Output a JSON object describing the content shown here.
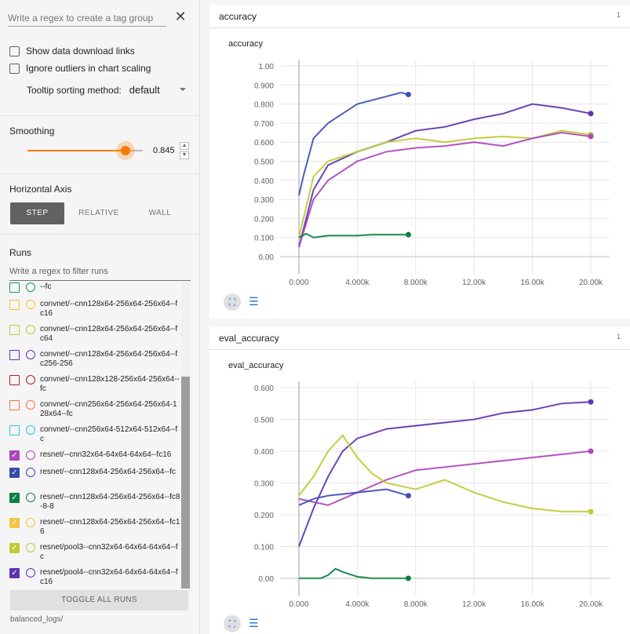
{
  "sidebar": {
    "tag_regex_placeholder": "Write a regex to create a tag group",
    "show_download_links": "Show data download links",
    "ignore_outliers": "Ignore outliers in chart scaling",
    "tooltip_sorting_label": "Tooltip sorting method:",
    "tooltip_sorting_value": "default",
    "smoothing_title": "Smoothing",
    "smoothing_value": "0.845",
    "smoothing_level": 0.845,
    "horizontal_axis_title": "Horizontal Axis",
    "axis_buttons": [
      "STEP",
      "RELATIVE",
      "WALL"
    ],
    "axis_selected": "STEP",
    "runs_title": "Runs",
    "runs_filter_placeholder": "Write a regex to filter runs",
    "runs": [
      {
        "label": "--fc",
        "color": "#0f9d58",
        "checked": false
      },
      {
        "label": "convnet/--cnn128x64-256x64-256x64--fc16",
        "color": "#f4c430",
        "checked": false
      },
      {
        "label": "convnet/--cnn128x64-256x64-256x64--fc64",
        "color": "#c0ca33",
        "checked": false
      },
      {
        "label": "convnet/--cnn128x64-256x64-256x64--fc256-256",
        "color": "#5e35b1",
        "checked": false
      },
      {
        "label": "convnet/--cnn128x128-256x64-256x64--fc",
        "color": "#b71c1c",
        "checked": false
      },
      {
        "label": "convnet/--cnn256x64-256x64-256x64-128x64--fc",
        "color": "#ff7043",
        "checked": false
      },
      {
        "label": "convnet/--cnn256x64-512x64-512x64--fc",
        "color": "#26c6da",
        "checked": false
      },
      {
        "label": "resnet/--cnn32x64-64x64-64x64--fc16",
        "color": "#ab47bc",
        "checked": true
      },
      {
        "label": "resnet/--cnn128x64-256x64-256x64--fc",
        "color": "#3949ab",
        "checked": true
      },
      {
        "label": "resnet/--cnn128x64-256x64-256x64--fc8-8-8",
        "color": "#0b8043",
        "checked": true
      },
      {
        "label": "resnet/--cnn128x64-256x64-256x64--fc16",
        "color": "#f6c342",
        "checked": true
      },
      {
        "label": "resnet/pool3--cnn32x64-64x64-64x64--fc",
        "color": "#c0ca33",
        "checked": true
      },
      {
        "label": "resnet/pool4--cnn32x64-64x64-64x64--fc16",
        "color": "#5e35b1",
        "checked": true
      }
    ],
    "toggle_all": "TOGGLE ALL RUNS",
    "logdir": "balanced_logs/"
  },
  "main": {
    "cards": [
      {
        "tag": "accuracy",
        "count": "1",
        "chart_title": "accuracy"
      },
      {
        "tag": "eval_accuracy",
        "count": "1",
        "chart_title": "eval_accuracy"
      }
    ]
  },
  "chart_data": [
    {
      "type": "line",
      "title": "accuracy",
      "xlim": [
        0,
        20000
      ],
      "ylim": [
        0,
        1.0
      ],
      "x_ticks": [
        "0.000",
        "4.000k",
        "8.000k",
        "12.00k",
        "16.00k",
        "20.00k"
      ],
      "y_ticks": [
        "0.00",
        "0.100",
        "0.200",
        "0.300",
        "0.400",
        "0.500",
        "0.600",
        "0.700",
        "0.800",
        "0.900",
        "1.00"
      ],
      "series": [
        {
          "color": "#3f51b5",
          "x": [
            0,
            300,
            1000,
            2000,
            3000,
            4000,
            5000,
            6000,
            7000,
            7500
          ],
          "y": [
            0.32,
            0.42,
            0.62,
            0.7,
            0.75,
            0.8,
            0.82,
            0.84,
            0.86,
            0.85
          ]
        },
        {
          "color": "#5e35b1",
          "x": [
            0,
            1000,
            2000,
            4000,
            6000,
            8000,
            10000,
            12000,
            14000,
            16000,
            18000,
            20000
          ],
          "y": [
            0.05,
            0.35,
            0.48,
            0.55,
            0.6,
            0.66,
            0.68,
            0.72,
            0.75,
            0.8,
            0.78,
            0.75
          ]
        },
        {
          "color": "#c0ca33",
          "x": [
            0,
            1000,
            2000,
            4000,
            6000,
            8000,
            10000,
            12000,
            14000,
            16000,
            18000,
            20000
          ],
          "y": [
            0.1,
            0.42,
            0.5,
            0.55,
            0.6,
            0.62,
            0.6,
            0.62,
            0.63,
            0.62,
            0.66,
            0.64
          ]
        },
        {
          "color": "#ab47bc",
          "x": [
            0,
            1000,
            2000,
            4000,
            6000,
            8000,
            10000,
            12000,
            14000,
            16000,
            18000,
            20000
          ],
          "y": [
            0.05,
            0.3,
            0.4,
            0.5,
            0.55,
            0.57,
            0.58,
            0.6,
            0.58,
            0.62,
            0.65,
            0.63
          ]
        },
        {
          "color": "#0b8043",
          "x": [
            0,
            500,
            1000,
            2000,
            3000,
            4000,
            5000,
            6000,
            7500
          ],
          "y": [
            0.1,
            0.12,
            0.1,
            0.11,
            0.11,
            0.11,
            0.115,
            0.115,
            0.115
          ]
        }
      ]
    },
    {
      "type": "line",
      "title": "eval_accuracy",
      "xlim": [
        0,
        20000
      ],
      "ylim": [
        0,
        0.6
      ],
      "x_ticks": [
        "0.000",
        "4.000k",
        "8.000k",
        "12.00k",
        "16.00k",
        "20.00k"
      ],
      "y_ticks": [
        "0.00",
        "0.100",
        "0.200",
        "0.300",
        "0.400",
        "0.500",
        "0.600"
      ],
      "series": [
        {
          "color": "#5e35b1",
          "x": [
            0,
            1000,
            2000,
            3000,
            4000,
            6000,
            8000,
            10000,
            12000,
            14000,
            16000,
            18000,
            20000
          ],
          "y": [
            0.1,
            0.22,
            0.32,
            0.4,
            0.44,
            0.47,
            0.48,
            0.49,
            0.5,
            0.52,
            0.53,
            0.55,
            0.555
          ]
        },
        {
          "color": "#ab47bc",
          "x": [
            0,
            1000,
            2000,
            4000,
            6000,
            8000,
            10000,
            12000,
            14000,
            16000,
            18000,
            20000
          ],
          "y": [
            0.25,
            0.24,
            0.23,
            0.27,
            0.31,
            0.34,
            0.35,
            0.36,
            0.37,
            0.38,
            0.39,
            0.4
          ]
        },
        {
          "color": "#c0ca33",
          "x": [
            0,
            1000,
            2000,
            3000,
            4000,
            5000,
            6000,
            8000,
            10000,
            12000,
            14000,
            16000,
            18000,
            20000
          ],
          "y": [
            0.26,
            0.32,
            0.4,
            0.45,
            0.38,
            0.33,
            0.3,
            0.28,
            0.31,
            0.27,
            0.24,
            0.22,
            0.21,
            0.21
          ]
        },
        {
          "color": "#3f51b5",
          "x": [
            0,
            1000,
            2000,
            4000,
            6000,
            7500
          ],
          "y": [
            0.23,
            0.25,
            0.26,
            0.27,
            0.28,
            0.26
          ]
        },
        {
          "color": "#0b8043",
          "x": [
            0,
            1500,
            2000,
            2500,
            3000,
            4000,
            5000,
            6000,
            7500
          ],
          "y": [
            0.0,
            0.0,
            0.01,
            0.03,
            0.02,
            0.005,
            0.0,
            0.0,
            0.0
          ]
        }
      ]
    }
  ]
}
